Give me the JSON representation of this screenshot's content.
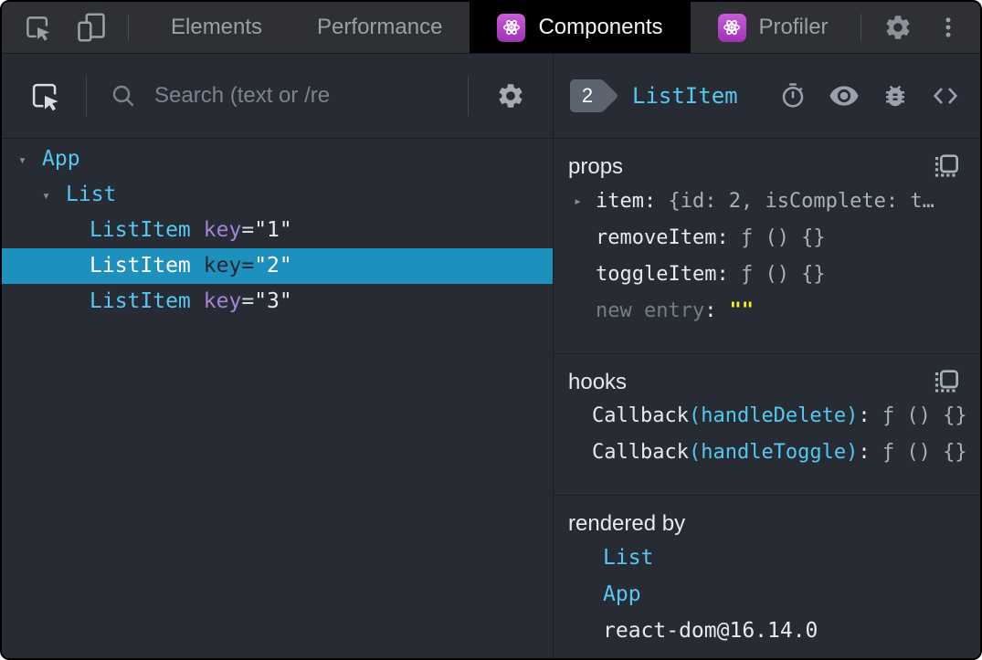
{
  "topbar": {
    "tabs": [
      {
        "label": "Elements"
      },
      {
        "label": "Performance"
      },
      {
        "label": "Components"
      },
      {
        "label": "Profiler"
      }
    ]
  },
  "left_panel": {
    "search_placeholder": "Search (text or /re",
    "expand_arrow": "▾",
    "tree": [
      {
        "name": "App"
      },
      {
        "name": "List"
      },
      {
        "name": "ListItem",
        "attr": "key",
        "eq": "=",
        "value": "\"1\""
      },
      {
        "name": "ListItem",
        "attr": "key",
        "eq": "=",
        "value": "\"2\""
      },
      {
        "name": "ListItem",
        "attr": "key",
        "eq": "=",
        "value": "\"3\""
      }
    ]
  },
  "right_panel": {
    "badge": "2",
    "title": "ListItem",
    "props": {
      "title": "props",
      "expand_arrow": "▸",
      "rows": [
        {
          "name": "item",
          "sep": ": ",
          "value": "{id: 2, isComplete: t…"
        },
        {
          "name": "removeItem",
          "sep": ": ",
          "value": "ƒ () {}"
        },
        {
          "name": "toggleItem",
          "sep": ": ",
          "value": "ƒ () {}"
        },
        {
          "name": "new entry",
          "sep": ":",
          "value": "\"\""
        }
      ]
    },
    "hooks": {
      "title": "hooks",
      "rows": [
        {
          "fn": "Callback",
          "arg": "(handleDelete)",
          "sep": ": ",
          "value": "ƒ () {}"
        },
        {
          "fn": "Callback",
          "arg": "(handleToggle)",
          "sep": ": ",
          "value": "ƒ () {}"
        }
      ]
    },
    "rendered_by": {
      "title": "rendered by",
      "items": [
        "List",
        "App",
        "react-dom@16.14.0"
      ]
    }
  },
  "colors": {
    "component_cyan": "#56c7ef",
    "attr_purple": "#a583d9",
    "selected_row_blue": "#1e90bd",
    "react_icon_purple": "#b44fc8",
    "empty_string_yellow": "#f7ef1e",
    "panel_background": "#272b33",
    "chrome_background": "#2e3034"
  }
}
